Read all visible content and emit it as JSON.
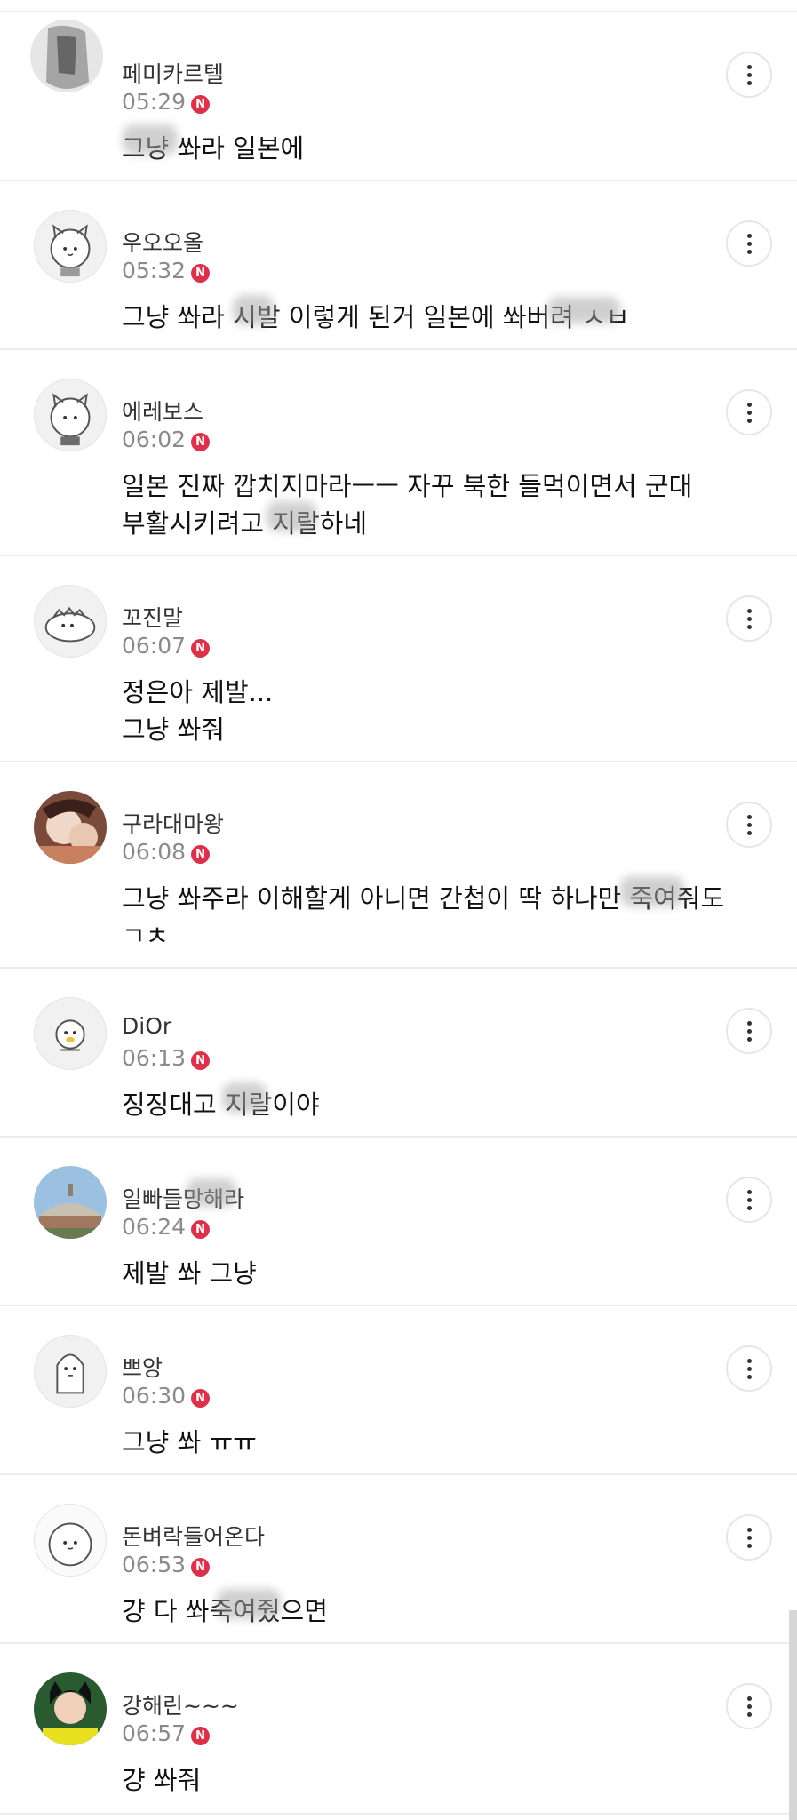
{
  "comments": [
    {
      "nickname": "페미카르텔",
      "time": "05:29",
      "badge": "N",
      "text": "그냥 쏴라 일본에"
    },
    {
      "nickname": "우오오올",
      "time": "05:32",
      "badge": "N",
      "text": "그냥 쏴라 시발 이렇게 된거 일본에 쏴버려 ㅅㅂ"
    },
    {
      "nickname": "에레보스",
      "time": "06:02",
      "badge": "N",
      "text": "일본 진짜 깝치지마라ㅡㅡ 자꾸 북한 들먹이면서 군대\n부활시키려고 지랄하네"
    },
    {
      "nickname": "꼬진말",
      "time": "06:07",
      "badge": "N",
      "text": "정은아 제발...\n그냥 쏴줘"
    },
    {
      "nickname": "구라대마왕",
      "time": "06:08",
      "badge": "N",
      "text": "그냥 쏴주라 이해할게 아니면 간첩이 딱 하나만 죽여줘도\nㄱㅊ"
    },
    {
      "nickname": "DiOr",
      "time": "06:13",
      "badge": "N",
      "text": "징징대고 지랄이야"
    },
    {
      "nickname": "일빠들망해라",
      "time": "06:24",
      "badge": "N",
      "text": "제발 쏴 그냥"
    },
    {
      "nickname": "쁘앙",
      "time": "06:30",
      "badge": "N",
      "text": "그냥 쏴 ㅠㅠ"
    },
    {
      "nickname": "돈벼락들어온다",
      "time": "06:53",
      "badge": "N",
      "text": "걍 다 쏴죽여줬으면"
    },
    {
      "nickname": "강해린~~~",
      "time": "06:57",
      "badge": "N",
      "text": "걍 쏴줘"
    }
  ],
  "icons": {
    "more": "more-vertical-icon",
    "badge": "new-badge-icon"
  },
  "colors": {
    "badge": "#d9324a",
    "divider": "#ececec",
    "time": "#8a8a8a"
  }
}
